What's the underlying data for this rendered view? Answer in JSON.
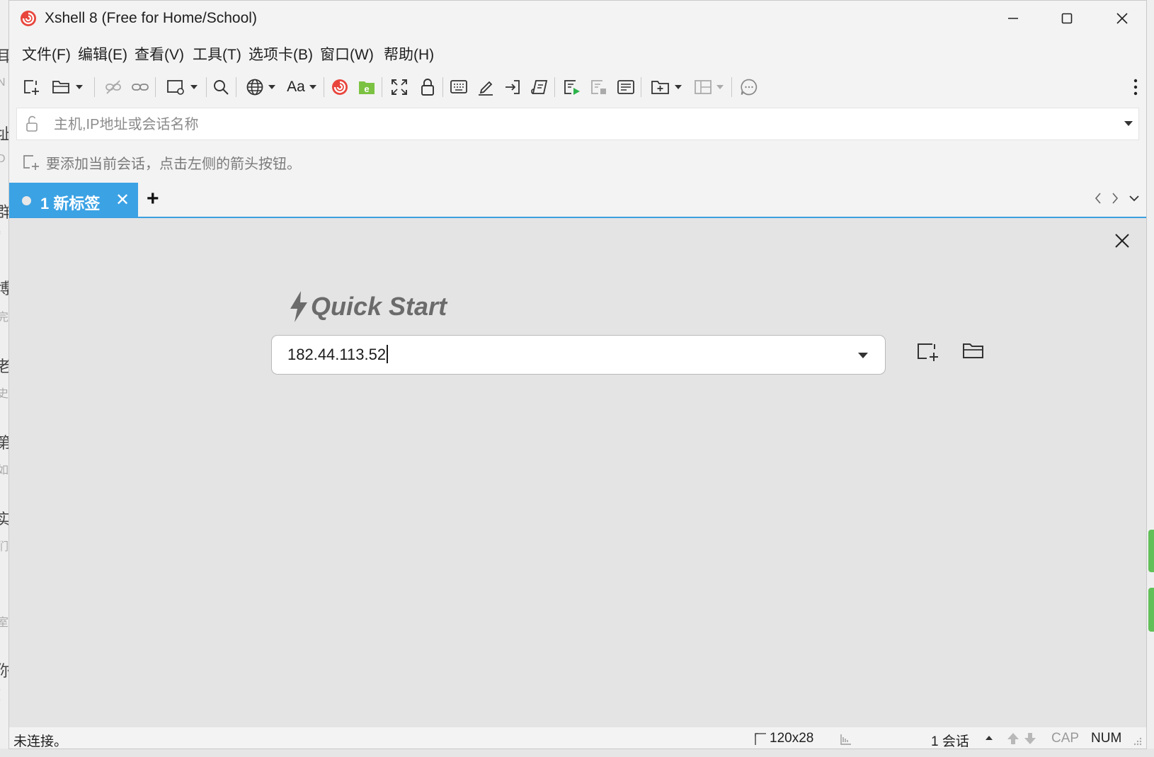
{
  "window": {
    "title": "Xshell 8 (Free for Home/School)"
  },
  "menu": {
    "items": [
      "文件(F)",
      "编辑(E)",
      "查看(V)",
      "工具(T)",
      "选项卡(B)",
      "窗口(W)",
      "帮助(H)"
    ]
  },
  "toolbar": {
    "font_button_label": "Aa",
    "icons": [
      "new-session-icon",
      "open-session-icon",
      "disconnect-icon",
      "reconnect-icon",
      "session-properties-icon",
      "find-icon",
      "encoding-icon",
      "font-icon",
      "xshell-logo-icon",
      "xftp-icon",
      "fullscreen-icon",
      "lock-icon",
      "compose-bar-icon",
      "highlight-icon",
      "transfer-icon",
      "script-icon",
      "record-icon",
      "stop-record-icon",
      "log-icon",
      "new-tab-group-icon",
      "layout-icon",
      "chat-icon",
      "more-icon"
    ]
  },
  "address_bar": {
    "placeholder": "主机,IP地址或会话名称"
  },
  "hint": {
    "text": "要添加当前会话，点击左侧的箭头按钮。"
  },
  "tabs": {
    "items": [
      {
        "label": "1 新标签"
      }
    ],
    "add_label": "+"
  },
  "quick_start": {
    "title": "Quick Start",
    "host_value": "182.44.113.52"
  },
  "status": {
    "connection": "未连接。",
    "terminal_size": "120x28",
    "sessions": "1 会话",
    "caps": "CAP",
    "num": "NUM"
  },
  "colors": {
    "accent": "#3ba2e4",
    "window_bg": "#f3f3f3",
    "content_bg": "#e4e4e4"
  }
}
